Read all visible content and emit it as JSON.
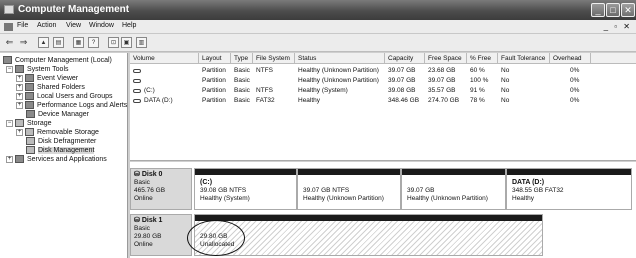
{
  "window": {
    "title": "Computer Management",
    "controls": {
      "minimize": "_",
      "maximize": "□",
      "close": "✕"
    },
    "mdi_controls": "_ ▫ ✕"
  },
  "menu": [
    "File",
    "Action",
    "View",
    "Window",
    "Help"
  ],
  "toolbar": {
    "icons": [
      "back-arrow-icon",
      "forward-arrow-icon",
      "up-folder-icon",
      "show-hide-tree-icon",
      "properties-icon",
      "help-icon",
      "connect-icon",
      "export-list-icon"
    ]
  },
  "tree": [
    {
      "label": "Computer Management (Local)",
      "level": 0,
      "expander": "",
      "icon": "computer-icon"
    },
    {
      "label": "System Tools",
      "level": 1,
      "expander": "−",
      "icon": "tools-icon"
    },
    {
      "label": "Event Viewer",
      "level": 2,
      "expander": "+",
      "icon": "event-viewer-icon"
    },
    {
      "label": "Shared Folders",
      "level": 2,
      "expander": "+",
      "icon": "shared-folders-icon"
    },
    {
      "label": "Local Users and Groups",
      "level": 2,
      "expander": "+",
      "icon": "users-icon"
    },
    {
      "label": "Performance Logs and Alerts",
      "level": 2,
      "expander": "+",
      "icon": "performance-icon"
    },
    {
      "label": "Device Manager",
      "level": 2,
      "expander": "",
      "icon": "device-manager-icon"
    },
    {
      "label": "Storage",
      "level": 1,
      "expander": "−",
      "icon": "storage-icon"
    },
    {
      "label": "Removable Storage",
      "level": 2,
      "expander": "+",
      "icon": "removable-storage-icon"
    },
    {
      "label": "Disk Defragmenter",
      "level": 2,
      "expander": "",
      "icon": "defragmenter-icon"
    },
    {
      "label": "Disk Management",
      "level": 2,
      "expander": "",
      "icon": "disk-management-icon",
      "selected": true
    },
    {
      "label": "Services and Applications",
      "level": 1,
      "expander": "+",
      "icon": "services-icon"
    }
  ],
  "volumes": {
    "columns": [
      "Volume",
      "Layout",
      "Type",
      "File System",
      "Status",
      "Capacity",
      "Free Space",
      "% Free",
      "Fault Tolerance",
      "Overhead"
    ],
    "rows": [
      [
        "",
        "Partition",
        "Basic",
        "NTFS",
        "Healthy (Unknown Partition)",
        "39.07 GB",
        "23.68 GB",
        "60 %",
        "No",
        "0%"
      ],
      [
        "",
        "Partition",
        "Basic",
        "",
        "Healthy (Unknown Partition)",
        "39.07 GB",
        "39.07 GB",
        "100 %",
        "No",
        "0%"
      ],
      [
        "(C:)",
        "Partition",
        "Basic",
        "NTFS",
        "Healthy (System)",
        "39.08 GB",
        "35.57 GB",
        "91 %",
        "No",
        "0%"
      ],
      [
        "DATA (D:)",
        "Partition",
        "Basic",
        "FAT32",
        "Healthy",
        "348.46 GB",
        "274.70 GB",
        "78 %",
        "No",
        "0%"
      ]
    ]
  },
  "disks": [
    {
      "name": "Disk 0",
      "type": "Basic",
      "size": "465.76 GB",
      "status": "Online",
      "partitions": [
        {
          "title": "(C:)",
          "line1": "39.08 GB NTFS",
          "line2": "Healthy (System)"
        },
        {
          "title": "",
          "line1": "39.07 GB NTFS",
          "line2": "Healthy (Unknown Partition)"
        },
        {
          "title": "",
          "line1": "39.07 GB",
          "line2": "Healthy (Unknown Partition)"
        },
        {
          "title": "DATA (D:)",
          "line1": "348.55 GB FAT32",
          "line2": "Healthy"
        }
      ]
    },
    {
      "name": "Disk 1",
      "type": "Basic",
      "size": "29.80 GB",
      "status": "Online",
      "partitions": [
        {
          "title": "",
          "line1": "29.80 GB",
          "line2": "Unallocated"
        }
      ]
    }
  ]
}
